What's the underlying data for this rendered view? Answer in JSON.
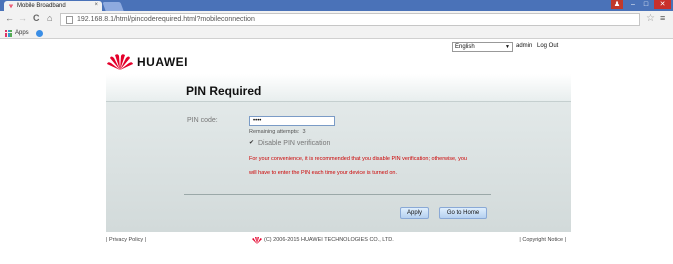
{
  "browser": {
    "tab_title": "Mobile Broadband",
    "tab_close": "×",
    "address": "192.168.8.1/html/pincoderequired.html?mobileconnection",
    "bookmarks_apps_label": "Apps",
    "window_user": "♟",
    "window_min": "–",
    "window_max": "□",
    "window_close": "✕"
  },
  "header": {
    "brand": "HUAWEI",
    "language_selected": "English",
    "user": "admin",
    "logout": "Log Out"
  },
  "pin_panel": {
    "title": "PIN Required",
    "pin_label": "PIN code:",
    "pin_value": "••••",
    "remaining_label": "Remaining attempts:",
    "remaining_count": "3",
    "disable_pin_label": "Disable PIN verification",
    "disable_pin_checked": true,
    "warning_line1": "For your convenience, it is recommended that you disable PIN verification; otherwise, you",
    "warning_line2": "will have to enter the PIN each time your device is turned on.",
    "apply_label": "Apply",
    "home_label": "Go to Home"
  },
  "footer": {
    "privacy": "| Privacy Policy |",
    "copyright": "(C) 2006-2015 HUAWEI TECHNOLOGIES CO., LTD.",
    "notice": "| Copyright Notice |"
  },
  "colors": {
    "brand_red": "#e4002b",
    "warning_red": "#cc0000",
    "chrome_blue": "#4a72b8"
  },
  "icons": {
    "back": "back-arrow-icon",
    "forward": "forward-arrow-icon",
    "reload": "reload-icon",
    "home": "home-icon",
    "star": "bookmark-star-icon",
    "menu": "chrome-menu-icon"
  }
}
